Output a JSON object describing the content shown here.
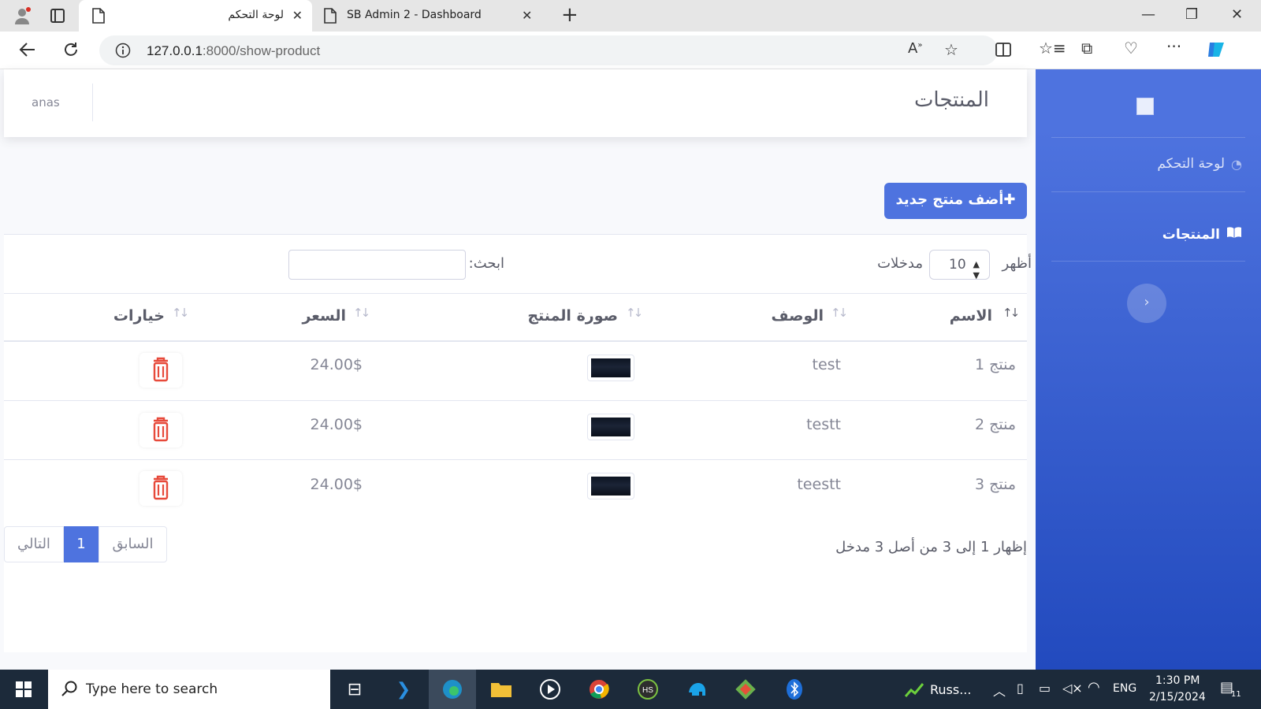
{
  "browser": {
    "tabs": [
      {
        "title": "لوحة التحكم"
      },
      {
        "title": "SB Admin 2 - Dashboard"
      }
    ],
    "url_host": "127.0.0.1",
    "url_rest": ":8000/show-product"
  },
  "sidebar": {
    "items": [
      {
        "label": "لوحة التحكم",
        "icon": "tachometer-icon"
      },
      {
        "label": "المنتجات",
        "icon": "book-open-icon"
      }
    ],
    "toggle": "›"
  },
  "topbar": {
    "title": "المنتجات",
    "user": "anas"
  },
  "actions": {
    "add_label": "✚أضف منتج جديد"
  },
  "table_controls": {
    "show_label": "أظهر",
    "entries_label": "مدخلات",
    "page_size": "10",
    "search_label": "ابحث:"
  },
  "table": {
    "headers": [
      "الاسم",
      "الوصف",
      "صورة المنتج",
      "السعر",
      "خيارات"
    ],
    "rows": [
      {
        "name": "منتج 1",
        "desc": "test",
        "price": "24.00$"
      },
      {
        "name": "منتج 2",
        "desc": "testt",
        "price": "24.00$"
      },
      {
        "name": "منتج 3",
        "desc": "teestt",
        "price": "24.00$"
      }
    ]
  },
  "pagination": {
    "info": "إظهار 1 إلى 3 من أصل 3 مدخل",
    "prev": "السابق",
    "current": "1",
    "next": "التالي"
  },
  "taskbar": {
    "search_placeholder": "Type here to search",
    "tray_app": "Russ...",
    "lang": "ENG",
    "time": "1:30 PM",
    "date": "2/15/2024",
    "notif_count": "11"
  },
  "colors": {
    "primary": "#4e73df",
    "danger": "#e74a3b",
    "text": "#5a5c69"
  }
}
